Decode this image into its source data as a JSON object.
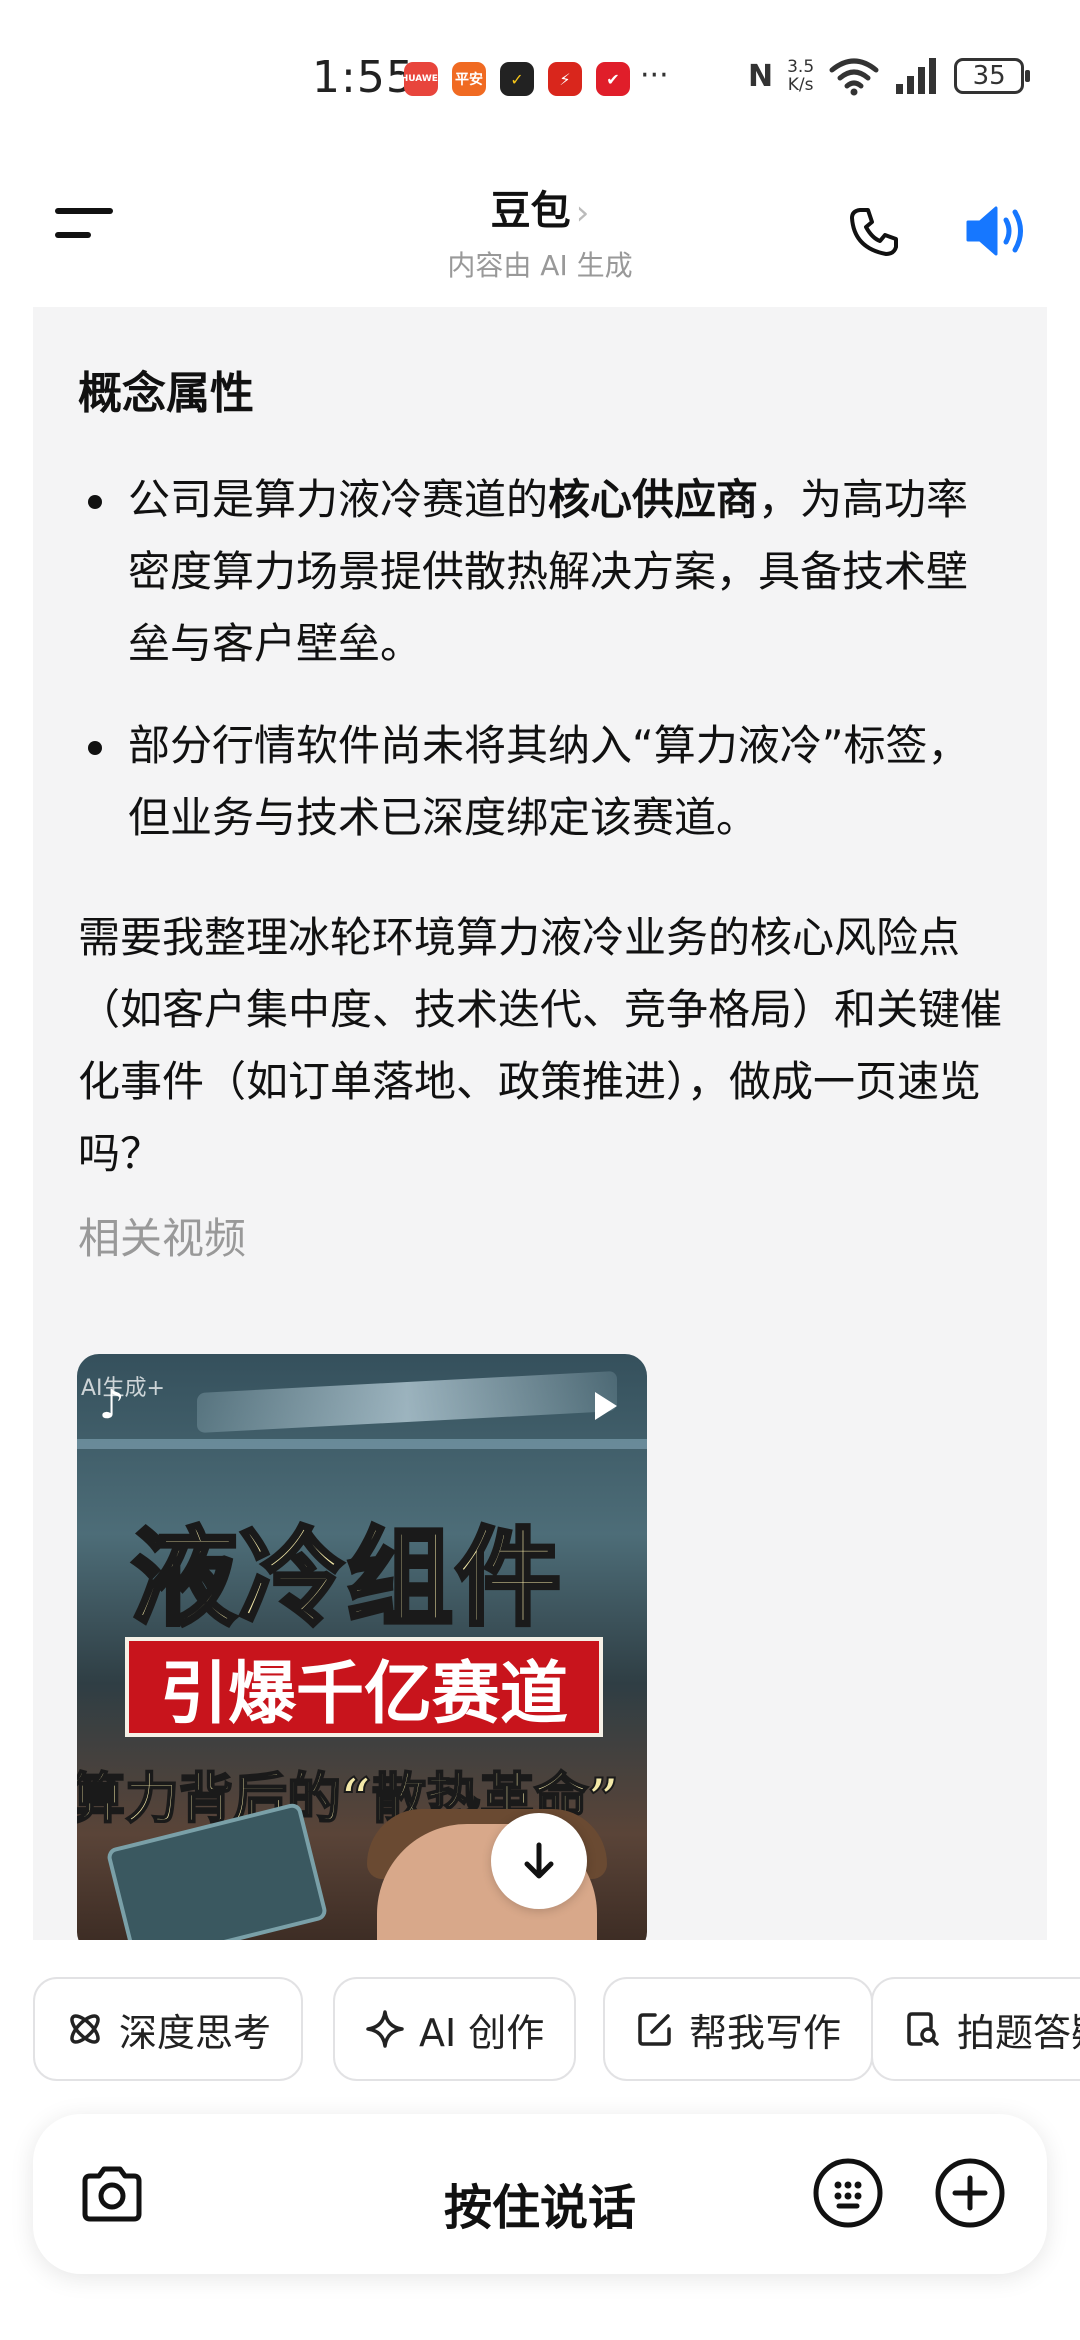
{
  "status_bar": {
    "time": "1:55",
    "app_icons": [
      {
        "name": "huawei-app-icon",
        "label": "HUAWEI",
        "color": "#e8453c"
      },
      {
        "name": "pingan-bank-icon",
        "label": "平安",
        "color": "#f06a22"
      },
      {
        "name": "app-icon-3",
        "label": "✓",
        "color": "#222222"
      },
      {
        "name": "app-icon-4",
        "label": "⚡",
        "color": "#d9261c"
      },
      {
        "name": "app-icon-5",
        "label": "✔",
        "color": "#e01e2a"
      }
    ],
    "more": "···",
    "nfc": "N",
    "net_speed_value": "3.5",
    "net_speed_unit": "K/s",
    "battery": "35"
  },
  "header": {
    "title": "豆包",
    "subtitle": "内容由 AI 生成",
    "accent_color": "#1677ff"
  },
  "content": {
    "section_title": "概念属性",
    "bullets": [
      {
        "pre": "公司是算力液冷赛道的",
        "bold": "核心供应商",
        "post": "，为高功率密度算力场景提供散热解决方案，具备技术壁垒与客户壁垒。"
      },
      {
        "pre": "部分行情软件尚未将其纳入“算力液冷”标签，但业务与技术已深度绑定该赛道。",
        "bold": "",
        "post": ""
      }
    ],
    "paragraph": "需要我整理冰轮环境算力液冷业务的核心风险点（如客户集中度、技术迭代、竞争格局）和关键催化事件（如订单落地、政策推进），做成一页速览吗？",
    "related_label": "相关视频",
    "video": {
      "ai_tag": "AI生成+",
      "title_line1": "液冷组件",
      "title_line2": "引爆千亿赛道",
      "title_line3": "算力背后的“散热革命”"
    }
  },
  "chips": [
    {
      "label": "深度思考",
      "icon": "atom-icon"
    },
    {
      "label": "AI 创作",
      "icon": "sparkle-icon"
    },
    {
      "label": "帮我写作",
      "icon": "edit-icon"
    },
    {
      "label": "拍题答疑",
      "icon": "doc-search-icon"
    }
  ],
  "input_bar": {
    "hold_to_talk": "按住说话"
  }
}
